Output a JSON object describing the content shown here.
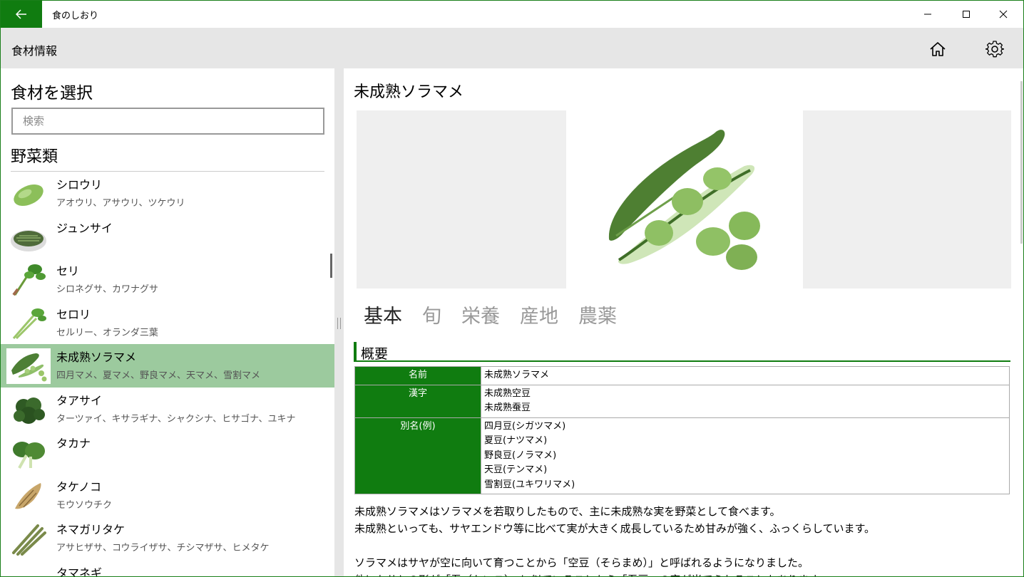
{
  "app": {
    "title": "食のしおり"
  },
  "header": {
    "title": "食材情報"
  },
  "left": {
    "heading": "食材を選択",
    "search_placeholder": "検索",
    "category": "野菜類",
    "items": [
      {
        "name": "シロウリ",
        "alias": "アオウリ、アサウリ、ツケウリ",
        "icon": "white-melon-icon"
      },
      {
        "name": "ジュンサイ",
        "alias": "",
        "icon": "junsai-icon"
      },
      {
        "name": "セリ",
        "alias": "シロネグサ、カワナグサ",
        "icon": "seri-icon"
      },
      {
        "name": "セロリ",
        "alias": "セルリー、オランダ三葉",
        "icon": "celery-icon"
      },
      {
        "name": "未成熟ソラマメ",
        "alias": "四月マメ、夏マメ、野良マメ、天マメ、雪割マメ",
        "icon": "fava-bean-icon",
        "selected": true
      },
      {
        "name": "タアサイ",
        "alias": "ターツァイ、キサラギナ、シャクシナ、ヒサゴナ、ユキナ",
        "icon": "tatsoi-icon"
      },
      {
        "name": "タカナ",
        "alias": "",
        "icon": "takana-icon"
      },
      {
        "name": "タケノコ",
        "alias": "モウソウチク",
        "icon": "bamboo-shoot-icon"
      },
      {
        "name": "ネマガリタケ",
        "alias": "アサヒザサ、コウライザサ、チシマザサ、ヒメタケ",
        "icon": "nemagaritake-icon"
      },
      {
        "name": "タマネギ",
        "alias": "",
        "icon": "onion-icon"
      }
    ]
  },
  "detail": {
    "title": "未成熟ソラマメ",
    "image": "fava-bean-photo",
    "tabs": [
      "基本",
      "旬",
      "栄養",
      "産地",
      "農薬"
    ],
    "section": "概要",
    "table": [
      {
        "key": "名前",
        "lines": [
          "未成熟ソラマメ"
        ]
      },
      {
        "key": "漢字",
        "lines": [
          "未成熟空豆",
          "未成熟蚕豆"
        ]
      },
      {
        "key": "別名(例)",
        "lines": [
          "四月豆(シガツマメ)",
          "夏豆(ナツマメ)",
          "野良豆(ノラマメ)",
          "天豆(テンマメ)",
          "雪割豆(ユキワリマメ)"
        ]
      }
    ],
    "description": [
      "未成熟ソラマメはソラマメを若取りしたもので、主に未成熟な実を野菜として食べます。",
      "未成熟といっても、サヤエンドウ等に比べて実が大きく成長しているため甘みが強く、ふっくらしています。",
      "",
      "ソラマメはサヤが空に向いて育つことから「空豆（そらまめ）」と呼ばれるようになりました。",
      "他にもサヤの形が「蚕（かいこ）」に似ていることから「蚕豆」の字が当てられることもあります。"
    ]
  },
  "colors": {
    "accent": "#107c10",
    "selected": "#9cca9e",
    "header_bg": "#e6e6e6"
  }
}
